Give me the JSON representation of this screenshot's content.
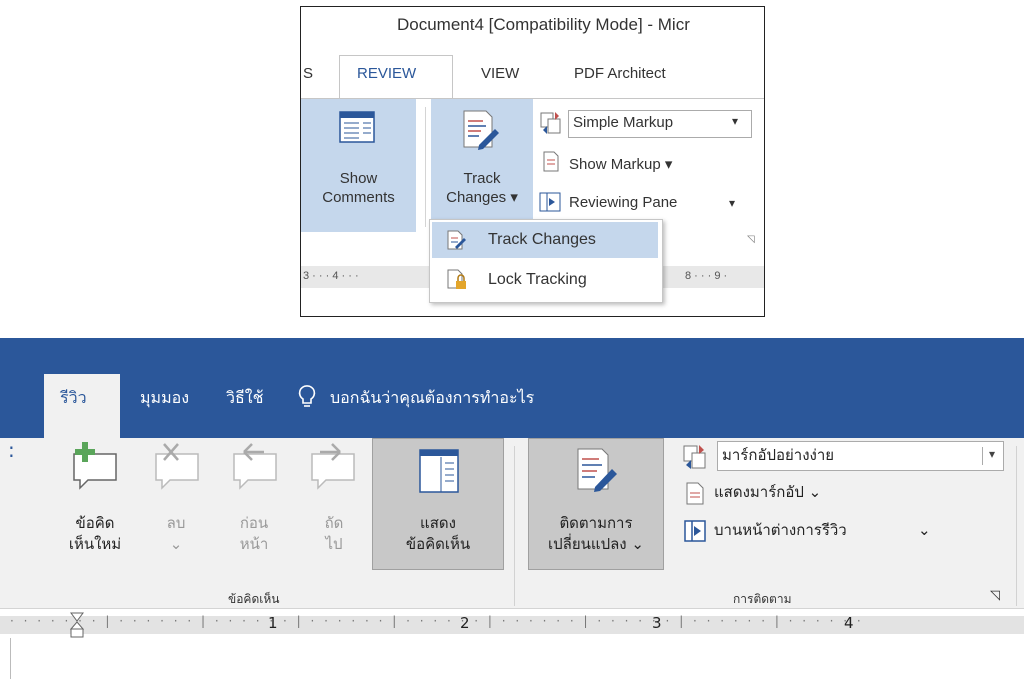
{
  "en_shot": {
    "title": "Document4 [Compatibility Mode] - Micr",
    "tabs": {
      "partial": "S",
      "review": "REVIEW",
      "view": "VIEW",
      "pdf": "PDF Architect"
    },
    "show_comments": {
      "line1": "Show",
      "line2": "Comments"
    },
    "track_changes": {
      "line1": "Track",
      "line2": "Changes ▾"
    },
    "markup_dropdown": {
      "value": "Simple Markup",
      "arrow": "▾"
    },
    "show_markup": "Show Markup ▾",
    "reviewing_pane": "Reviewing Pane",
    "reviewing_pane_arrow": "▾",
    "ruler": {
      "left": "3 · · · 4 · · ·",
      "right": "8 · · · 9 ·"
    },
    "menu": {
      "item1": "Track Changes",
      "item2": "Lock Tracking"
    },
    "colors": {
      "accent": "#2b579a",
      "highlight": "#c5d7ec"
    },
    "icons": [
      "show-comments-icon",
      "track-changes-icon",
      "compare-icon",
      "document-icon",
      "reviewing-pane-icon",
      "lock-document-icon"
    ]
  },
  "th_shot": {
    "tabs": {
      "review": "รีวิว",
      "view": "มุมมอง",
      "help": "วิธีใช้",
      "tell_me": "บอกฉันว่าคุณต้องการทำอะไร"
    },
    "comments_group": {
      "new_comment": {
        "line1": "ข้อคิด",
        "line2": "เห็นใหม่"
      },
      "delete": {
        "line1": "ลบ",
        "line2": "⌄"
      },
      "previous": {
        "line1": "ก่อน",
        "line2": "หน้า"
      },
      "next": {
        "line1": "ถัด",
        "line2": "ไป"
      },
      "show_comments": {
        "line1": "แสดง",
        "line2": "ข้อคิดเห็น"
      },
      "title": "ข้อคิดเห็น"
    },
    "tracking_group": {
      "track_changes": {
        "line1": "ติดตามการ",
        "line2": "เปลี่ยนแปลง ⌄"
      },
      "markup_dropdown": {
        "value": "มาร์กอัปอย่างง่าย",
        "arrow": "▾"
      },
      "show_markup": "แสดงมาร์กอัป ⌄",
      "reviewing_pane": "บานหน้าต่างการรีวิว",
      "reviewing_pane_arrow": "⌄",
      "title": "การติดตาม",
      "launcher": "◹"
    },
    "ruler_numbers": [
      "1",
      "2",
      "3",
      "4"
    ],
    "colors": {
      "titlebar": "#2b579a",
      "ribbon": "#f1f1f1",
      "pressed": "#c8c8c8",
      "new_comment_plus": "#5aa55a"
    },
    "icons": [
      "lightbulb-icon",
      "new-comment-icon",
      "delete-comment-icon",
      "previous-comment-icon",
      "next-comment-icon",
      "show-comments-icon",
      "track-changes-icon",
      "compare-icon",
      "document-icon",
      "reviewing-pane-icon",
      "dialog-launcher-icon"
    ]
  }
}
